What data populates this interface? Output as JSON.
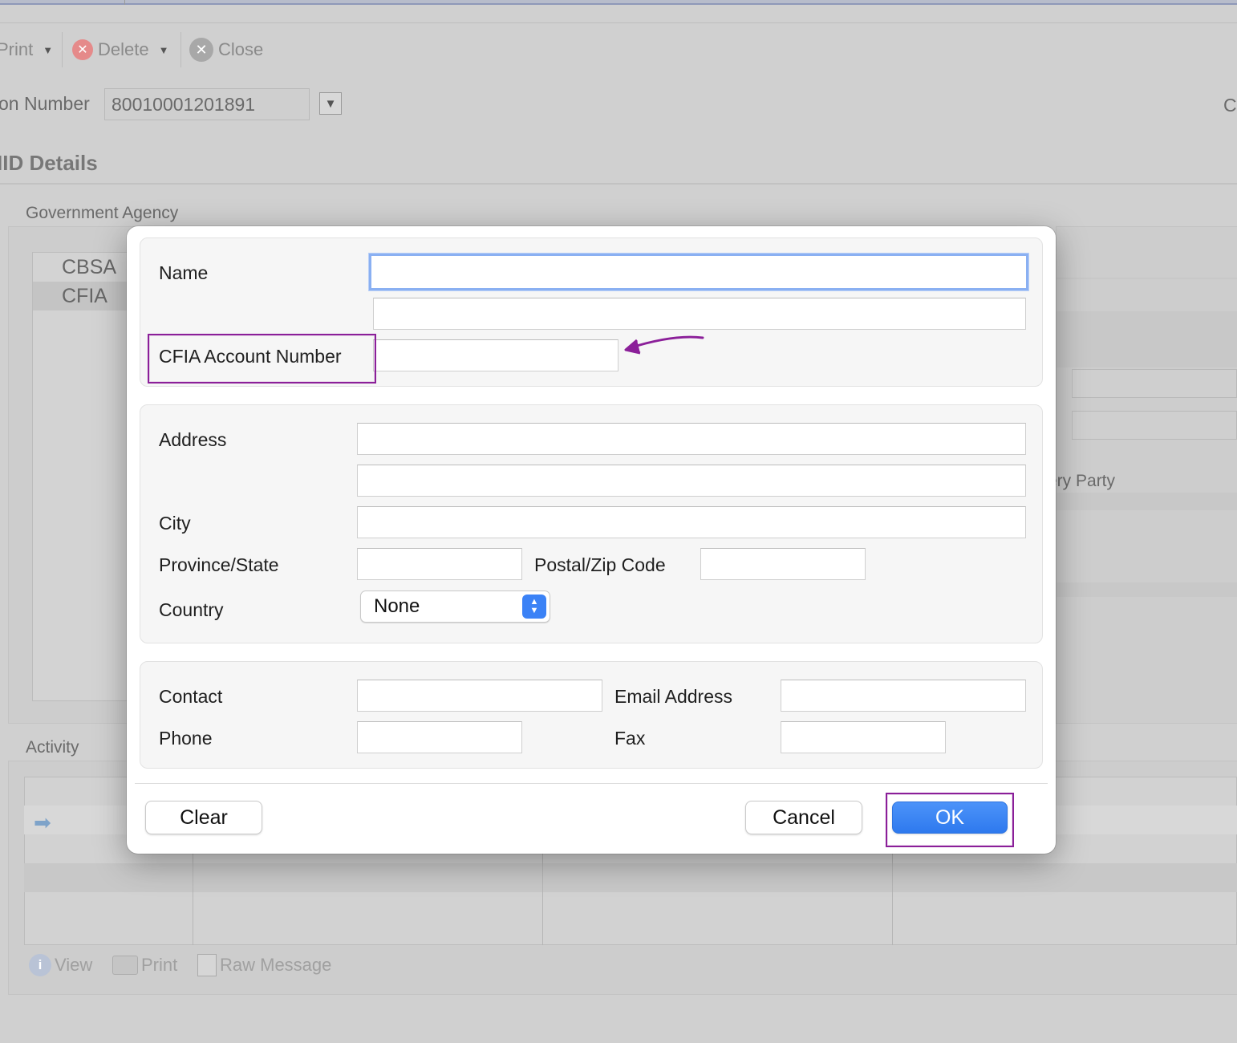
{
  "background": {
    "toolbar": {
      "print_label": "Print",
      "delete_label": "Delete",
      "close_label": "Close"
    },
    "transaction_label": "on Number",
    "transaction_value": "80010001201891",
    "right_edge_letter": "C",
    "section_heading": "IID Details",
    "gov_agency_label": "Government Agency",
    "agencies": [
      "CBSA",
      "CFIA"
    ],
    "right_partial_label": "ery Party",
    "activity_label": "Activity",
    "bottom_toolbar": {
      "view_label": "View",
      "print_label": "Print",
      "raw_message_label": "Raw Message"
    }
  },
  "dialog": {
    "name_label": "Name",
    "name_value": "",
    "name_line2_value": "",
    "cfia_account_label": "CFIA Account Number",
    "cfia_account_value": "",
    "address_label": "Address",
    "address_line1": "",
    "address_line2": "",
    "city_label": "City",
    "city_value": "",
    "province_label": "Province/State",
    "province_value": "",
    "postal_label": "Postal/Zip Code",
    "postal_value": "",
    "country_label": "Country",
    "country_value": "None",
    "contact_label": "Contact",
    "contact_value": "",
    "email_label": "Email Address",
    "email_value": "",
    "phone_label": "Phone",
    "phone_value": "",
    "fax_label": "Fax",
    "fax_value": "",
    "clear_button": "Clear",
    "cancel_button": "Cancel",
    "ok_button": "OK"
  },
  "colors": {
    "annotation": "#8b1f99",
    "primary_button": "#2e79ee",
    "focus_ring": "#8ab0f2"
  }
}
